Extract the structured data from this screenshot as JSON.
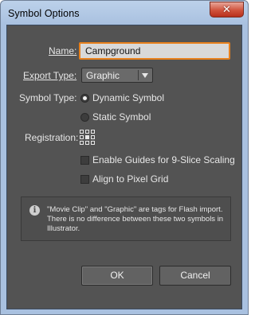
{
  "window": {
    "title": "Symbol Options",
    "close_glyph": "✕"
  },
  "name_field": {
    "label": "Name:",
    "value": "Campground"
  },
  "export_type": {
    "label": "Export Type:",
    "selected": "Graphic",
    "icon": "chevron-down-icon"
  },
  "symbol_type": {
    "label": "Symbol Type:",
    "options": [
      {
        "label": "Dynamic Symbol",
        "checked": true
      },
      {
        "label": "Static Symbol",
        "checked": false
      }
    ]
  },
  "registration": {
    "label": "Registration:",
    "icon": "registration-grid-icon"
  },
  "checkboxes": [
    {
      "label": "Enable Guides for 9-Slice Scaling",
      "checked": false
    },
    {
      "label": "Align to Pixel Grid",
      "checked": false
    }
  ],
  "info": {
    "icon": "info-icon",
    "glyph": "i",
    "text": "\"Movie Clip\" and \"Graphic\" are tags for Flash import. There is no difference between these two symbols in Illustrator."
  },
  "buttons": {
    "ok": "OK",
    "cancel": "Cancel"
  },
  "colors": {
    "panel": "#535353",
    "accent_focus": "#e8801c",
    "titlebar": "#a9c1e0"
  }
}
